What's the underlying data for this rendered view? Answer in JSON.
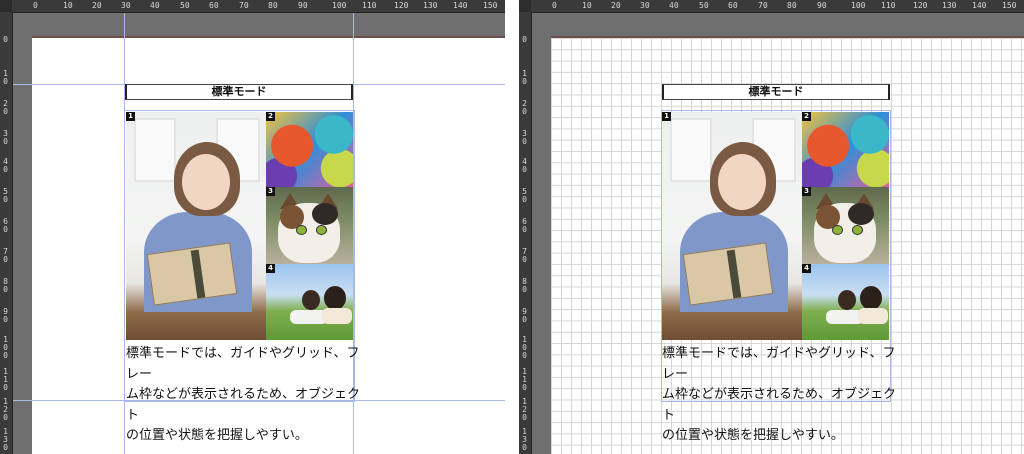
{
  "ruler": {
    "ticks": [
      "0",
      "10",
      "20",
      "30",
      "40",
      "50",
      "60",
      "70",
      "80",
      "90",
      "100",
      "110",
      "120",
      "130",
      "140",
      "150"
    ],
    "vticks": [
      "0",
      "10",
      "20",
      "30",
      "40",
      "50",
      "60",
      "70",
      "80",
      "90",
      "100",
      "110",
      "120",
      "130"
    ]
  },
  "panels": [
    {
      "id": "left",
      "mode_label": "標準モード",
      "badges": [
        "1",
        "2",
        "3",
        "4"
      ],
      "body_lines": [
        "標準モードでは、ガイドやグリッド、フレー",
        "ム枠などが表示されるため、オブジェクト",
        "の位置や状態を把握しやすい。"
      ]
    },
    {
      "id": "right",
      "mode_label": "標準モード",
      "badges": [
        "1",
        "2",
        "3",
        "4"
      ],
      "body_lines": [
        "標準モードでは、ガイドやグリッド、フレー",
        "ム枠などが表示されるため、オブジェクト",
        "の位置や状態を把握しやすい。"
      ]
    }
  ],
  "colors": {
    "guide": "#a9b9e6",
    "pasteboard": "#6f6f6f",
    "ruler": "#3a3a3a",
    "page_edge": "#6d2a2a"
  },
  "icons": {
    "photo1": "woman-with-book-photo",
    "photo2": "colorful-abstract-photo",
    "photo3": "cat-photo",
    "photo4": "kids-on-grass-photo"
  }
}
